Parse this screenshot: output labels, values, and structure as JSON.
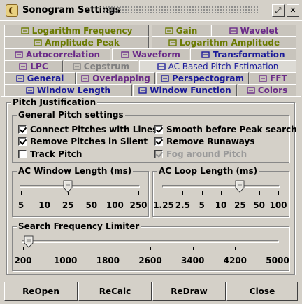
{
  "window": {
    "title": "Sonogram Settings"
  },
  "tabs": {
    "row1": [
      {
        "label": "Logarithm Frequency",
        "icon": "log-frequency-icon",
        "color": "olive"
      },
      {
        "label": "Gain",
        "icon": "gain-icon",
        "color": "olive"
      },
      {
        "label": "Wavelet",
        "icon": "wavelet-icon",
        "color": "purple"
      }
    ],
    "row2": [
      {
        "label": "Amplitude Peak",
        "icon": "amplitude-peak-icon",
        "color": "olive"
      },
      {
        "label": "Logarithm Amplitude",
        "icon": "log-amplitude-icon",
        "color": "olive"
      }
    ],
    "row3": [
      {
        "label": "Autocorrelation",
        "icon": "autocorrelation-icon",
        "color": "purple"
      },
      {
        "label": "Waveform",
        "icon": "waveform-icon",
        "color": "purple"
      },
      {
        "label": "Transformation",
        "icon": "transformation-icon",
        "color": "blue"
      }
    ],
    "row4": [
      {
        "label": "LPC",
        "icon": "lpc-icon",
        "color": "purple"
      },
      {
        "label": "Cepstrum",
        "icon": "cepstrum-icon",
        "color": "gray"
      },
      {
        "label": "AC Based Pitch Estimation",
        "icon": "pitch-icon",
        "color": "blue"
      }
    ],
    "row5": [
      {
        "label": "General",
        "icon": "general-icon",
        "color": "blue"
      },
      {
        "label": "Overlapping",
        "icon": "overlapping-icon",
        "color": "purple"
      },
      {
        "label": "Perspectogram",
        "icon": "perspectogram-icon",
        "color": "blue"
      },
      {
        "label": "FFT",
        "icon": "fft-icon",
        "color": "purple"
      }
    ],
    "row6": [
      {
        "label": "Window Length",
        "icon": "window-length-icon",
        "color": "blue"
      },
      {
        "label": "Window Function",
        "icon": "window-function-icon",
        "color": "blue"
      },
      {
        "label": "Colors",
        "icon": "colors-icon",
        "color": "purple"
      }
    ],
    "selected": "AC Based Pitch Estimation"
  },
  "panel": {
    "title": "Pitch Justification",
    "general": {
      "title": "General Pitch settings",
      "options": [
        {
          "label": "Connect Pitches with Lines",
          "checked": true,
          "enabled": true
        },
        {
          "label": "Smooth before Peak search",
          "checked": true,
          "enabled": true
        },
        {
          "label": "Remove Pitches in Silent",
          "checked": true,
          "enabled": true
        },
        {
          "label": "Remove Runaways",
          "checked": true,
          "enabled": true
        },
        {
          "label": "Track Pitch",
          "checked": false,
          "enabled": true
        },
        {
          "label": "Fog around Pitch",
          "checked": true,
          "enabled": false
        }
      ]
    },
    "ac_window": {
      "title": "AC Window Length (ms)",
      "ticks": [
        "5",
        "10",
        "25",
        "50",
        "100",
        "250"
      ],
      "value_index": 2
    },
    "ac_loop": {
      "title": "AC Loop Length (ms)",
      "ticks": [
        "1.25",
        "2.5",
        "5",
        "10",
        "25",
        "50",
        "100"
      ],
      "value_index": 4
    },
    "search_freq": {
      "title": "Search Frequency Limiter",
      "ticks": [
        "200",
        "1000",
        "1800",
        "2600",
        "3400",
        "4200",
        "5000"
      ],
      "value": 300
    }
  },
  "buttons": {
    "reopen": "ReOpen",
    "recalc": "ReCalc",
    "redraw": "ReDraw",
    "close": "Close"
  }
}
